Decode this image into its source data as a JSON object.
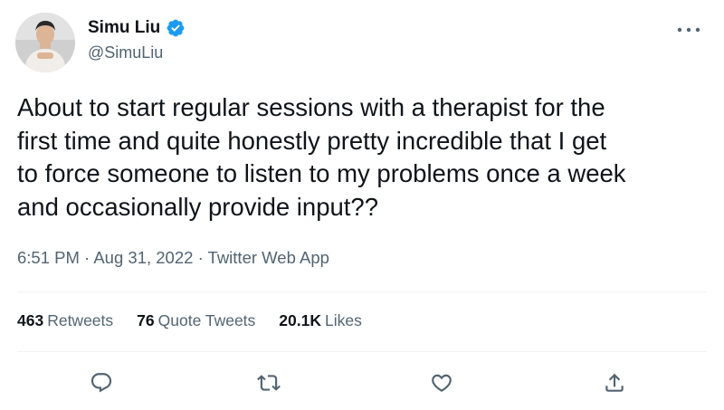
{
  "author": {
    "display_name": "Simu Liu",
    "handle": "@SimuLiu",
    "verified": true
  },
  "tweet": {
    "text": "About to start regular sessions with a therapist for the\nfirst time and quite honestly pretty incredible that I get\nto force someone to listen to my problems once a week\nand occasionally provide input??",
    "time": "6:51 PM",
    "separator": "·",
    "date": "Aug 31, 2022",
    "source": "Twitter Web App"
  },
  "stats": {
    "retweets_count": "463",
    "retweets_label": "Retweets",
    "quote_tweets_count": "76",
    "quote_tweets_label": "Quote Tweets",
    "likes_count": "20.1K",
    "likes_label": "Likes"
  },
  "actions": {
    "icons": [
      "reply-icon",
      "retweet-icon",
      "like-icon",
      "share-icon"
    ]
  },
  "colors": {
    "text_primary": "#0f1419",
    "text_secondary": "#536471",
    "verified_blue": "#1d9bf0",
    "divider": "#eff3f4"
  }
}
